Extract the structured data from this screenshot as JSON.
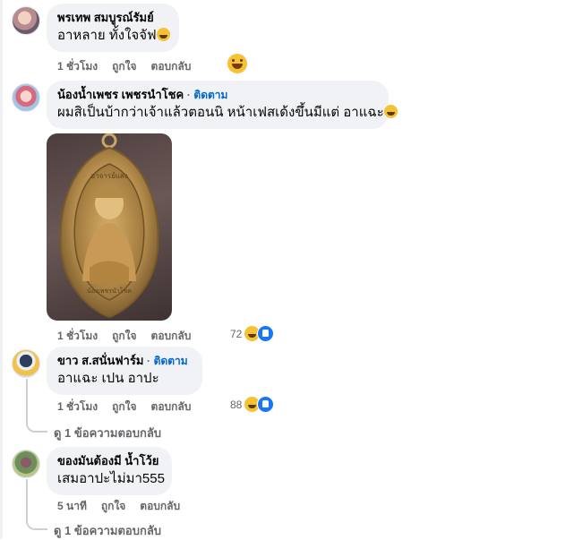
{
  "comments": [
    {
      "author": "พรเทพ สมบูรณ์รัมย์",
      "text": "อาหลาย ทั้งใจจัฟ",
      "time": "1 ชั่วโมง",
      "like": "ถูกใจ",
      "reply": "ตอบกลับ"
    },
    {
      "author": "น้องน้ำเพชร เพชรนำโชค",
      "follow": "ติดตาม",
      "text": "ผมสิเป็นบ้ากว่าเจ้าแล้วตอนนิ หน้าเฟสเด้งขึ้นมีแต่ อาแฉะ",
      "time": "1 ชั่วโมง",
      "like": "ถูกใจ",
      "reply": "ตอบกลับ",
      "reaction_count": "72",
      "image": {
        "top_label": "อาจารย์แสง",
        "bottom_label": "น้องเพชรนำโชค"
      }
    },
    {
      "author": "ขาว ส.สนั่นฟาร์ม",
      "follow": "ติดตาม",
      "text": "อาแฉะ เปน อาปะ",
      "time": "1 ชั่วโมง",
      "like": "ถูกใจ",
      "reply": "ตอบกลับ",
      "reaction_count": "88",
      "view_replies": "ดู 1 ข้อความตอบกลับ"
    },
    {
      "author": "ของมันต้องมี น้ำโว้ย",
      "text": "เสมอาปะไม่มา555",
      "time": "5 นาที",
      "like": "ถูกใจ",
      "reply": "ตอบกลับ",
      "view_replies": "ดู 1 ข้อความตอบกลับ"
    }
  ],
  "separator": "·",
  "colors": {
    "bubble": "#f0f2f5",
    "follow": "#0064d1",
    "meta": "#65676b",
    "like_blue": "#1877f2",
    "haha_yellow": "#f7c134"
  }
}
